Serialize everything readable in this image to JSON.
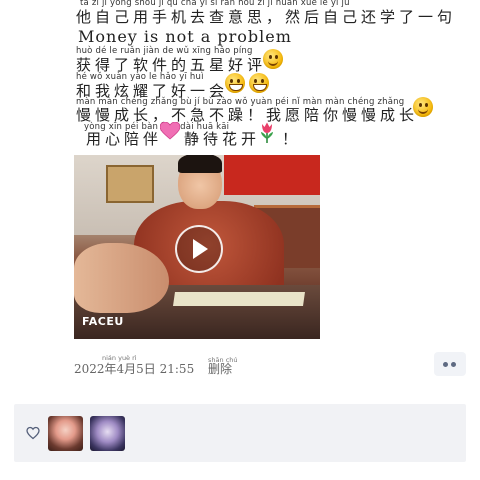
{
  "post": {
    "lines": [
      {
        "pinyin": "tā  zì  jǐ  yòng shǒu jī  qù  chá  yì  sī       rán hòu  zì  jǐ  huán xué  le  yī  jù",
        "text": "他自己用手机去查意思，然后自己还学了一句"
      },
      {
        "pinyin": "",
        "text": "Money is not a problem"
      },
      {
        "pinyin": "huò  dé   le  ruǎn jiàn  de  wǔ  xīng hǎo píng",
        "text": "获得了软件的五星好评"
      },
      {
        "pinyin": "hé  wǒ  xuàn yào  le  hǎo  yī  huì",
        "text": "和我炫耀了好一会"
      },
      {
        "pinyin": "màn màn chéng zhǎng     bù   jí   bù  zào      wǒ yuàn péi  nǐ  màn màn chéng zhǎng",
        "text": "慢慢成长，不急不躁！我愿陪你慢慢成长"
      },
      {
        "pinyin": "yòng xīn  péi bàn        jìng dài huā kāi",
        "text": "用心陪伴"
      },
      {
        "pinyin": "",
        "text": "静待花开"
      },
      {
        "pinyin": "",
        "text": "！"
      }
    ],
    "emojis": [
      "thinking-face",
      "grinning-face",
      "grinning-face",
      "smiling-face",
      "pink-heart",
      "tulip"
    ]
  },
  "video": {
    "watermark": "FACEU",
    "play_icon": "play-icon"
  },
  "meta": {
    "date": "2022年4月5日  21:55",
    "date_pinyin": "nián   yuè    rì",
    "delete_label": "删除",
    "delete_pinyin": "shān chú"
  },
  "likes": {
    "icon": "heart-outline-icon",
    "avatars": [
      "avatar-1",
      "avatar-2"
    ]
  },
  "colors": {
    "like_panel_bg": "#f1f2f5",
    "more_button_bg": "#f1f3f7",
    "more_dots": "#5e6a82"
  }
}
